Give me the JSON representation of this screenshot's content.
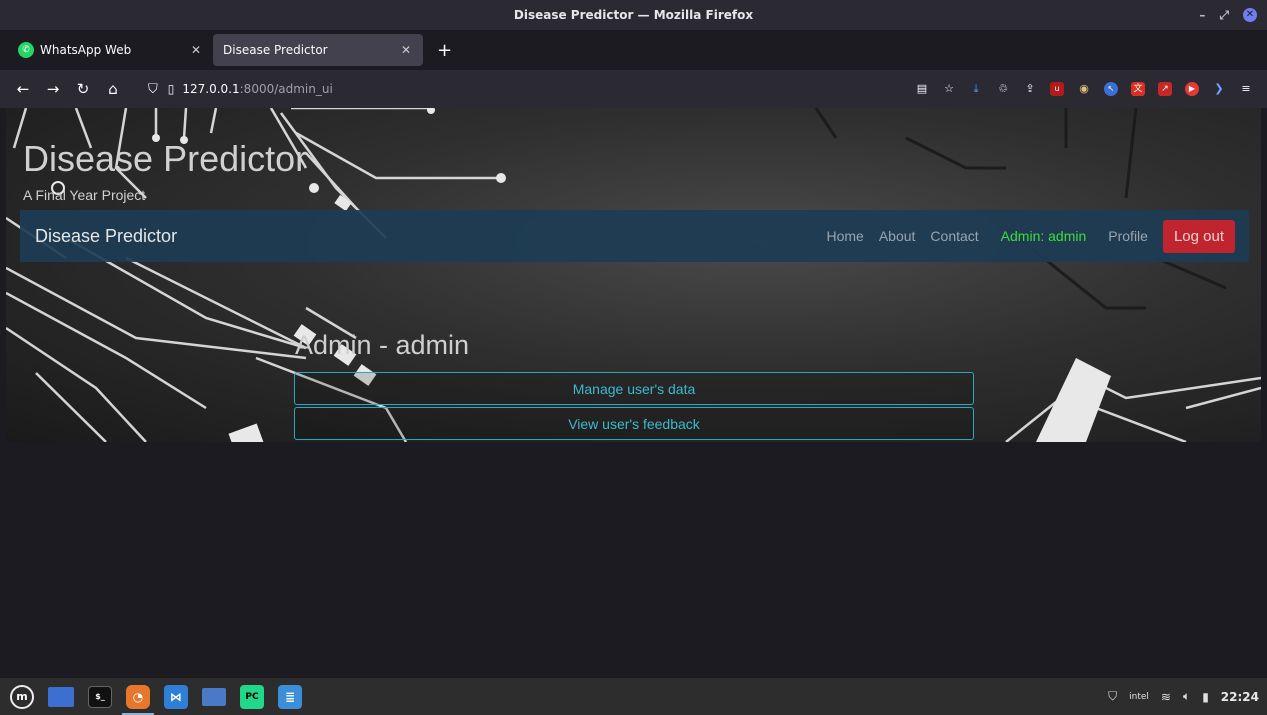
{
  "window": {
    "title": "Disease Predictor — Mozilla Firefox"
  },
  "tabs": [
    {
      "label": "WhatsApp Web"
    },
    {
      "label": "Disease Predictor"
    }
  ],
  "address": {
    "host": "127.0.0.1",
    "path": ":8000/admin_ui"
  },
  "site": {
    "title": "Disease Predictor",
    "subtitle": "A Final Year Project",
    "brand": "Disease Predictor",
    "nav": {
      "home": "Home",
      "about": "About",
      "contact": "Contact",
      "admin": "Admin: admin",
      "profile": "Profile",
      "logout": "Log out"
    }
  },
  "main": {
    "heading": "Admin - admin",
    "buttons": {
      "manage": "Manage user's data",
      "feedback": "View user's feedback"
    }
  },
  "taskbar": {
    "clock": "22:24"
  },
  "colors": {
    "accent_outline": "#2aa8c0",
    "admin_link": "#3ddc3d",
    "logout_bg": "#c0252f",
    "site_nav_bg": "#1c3c54"
  }
}
